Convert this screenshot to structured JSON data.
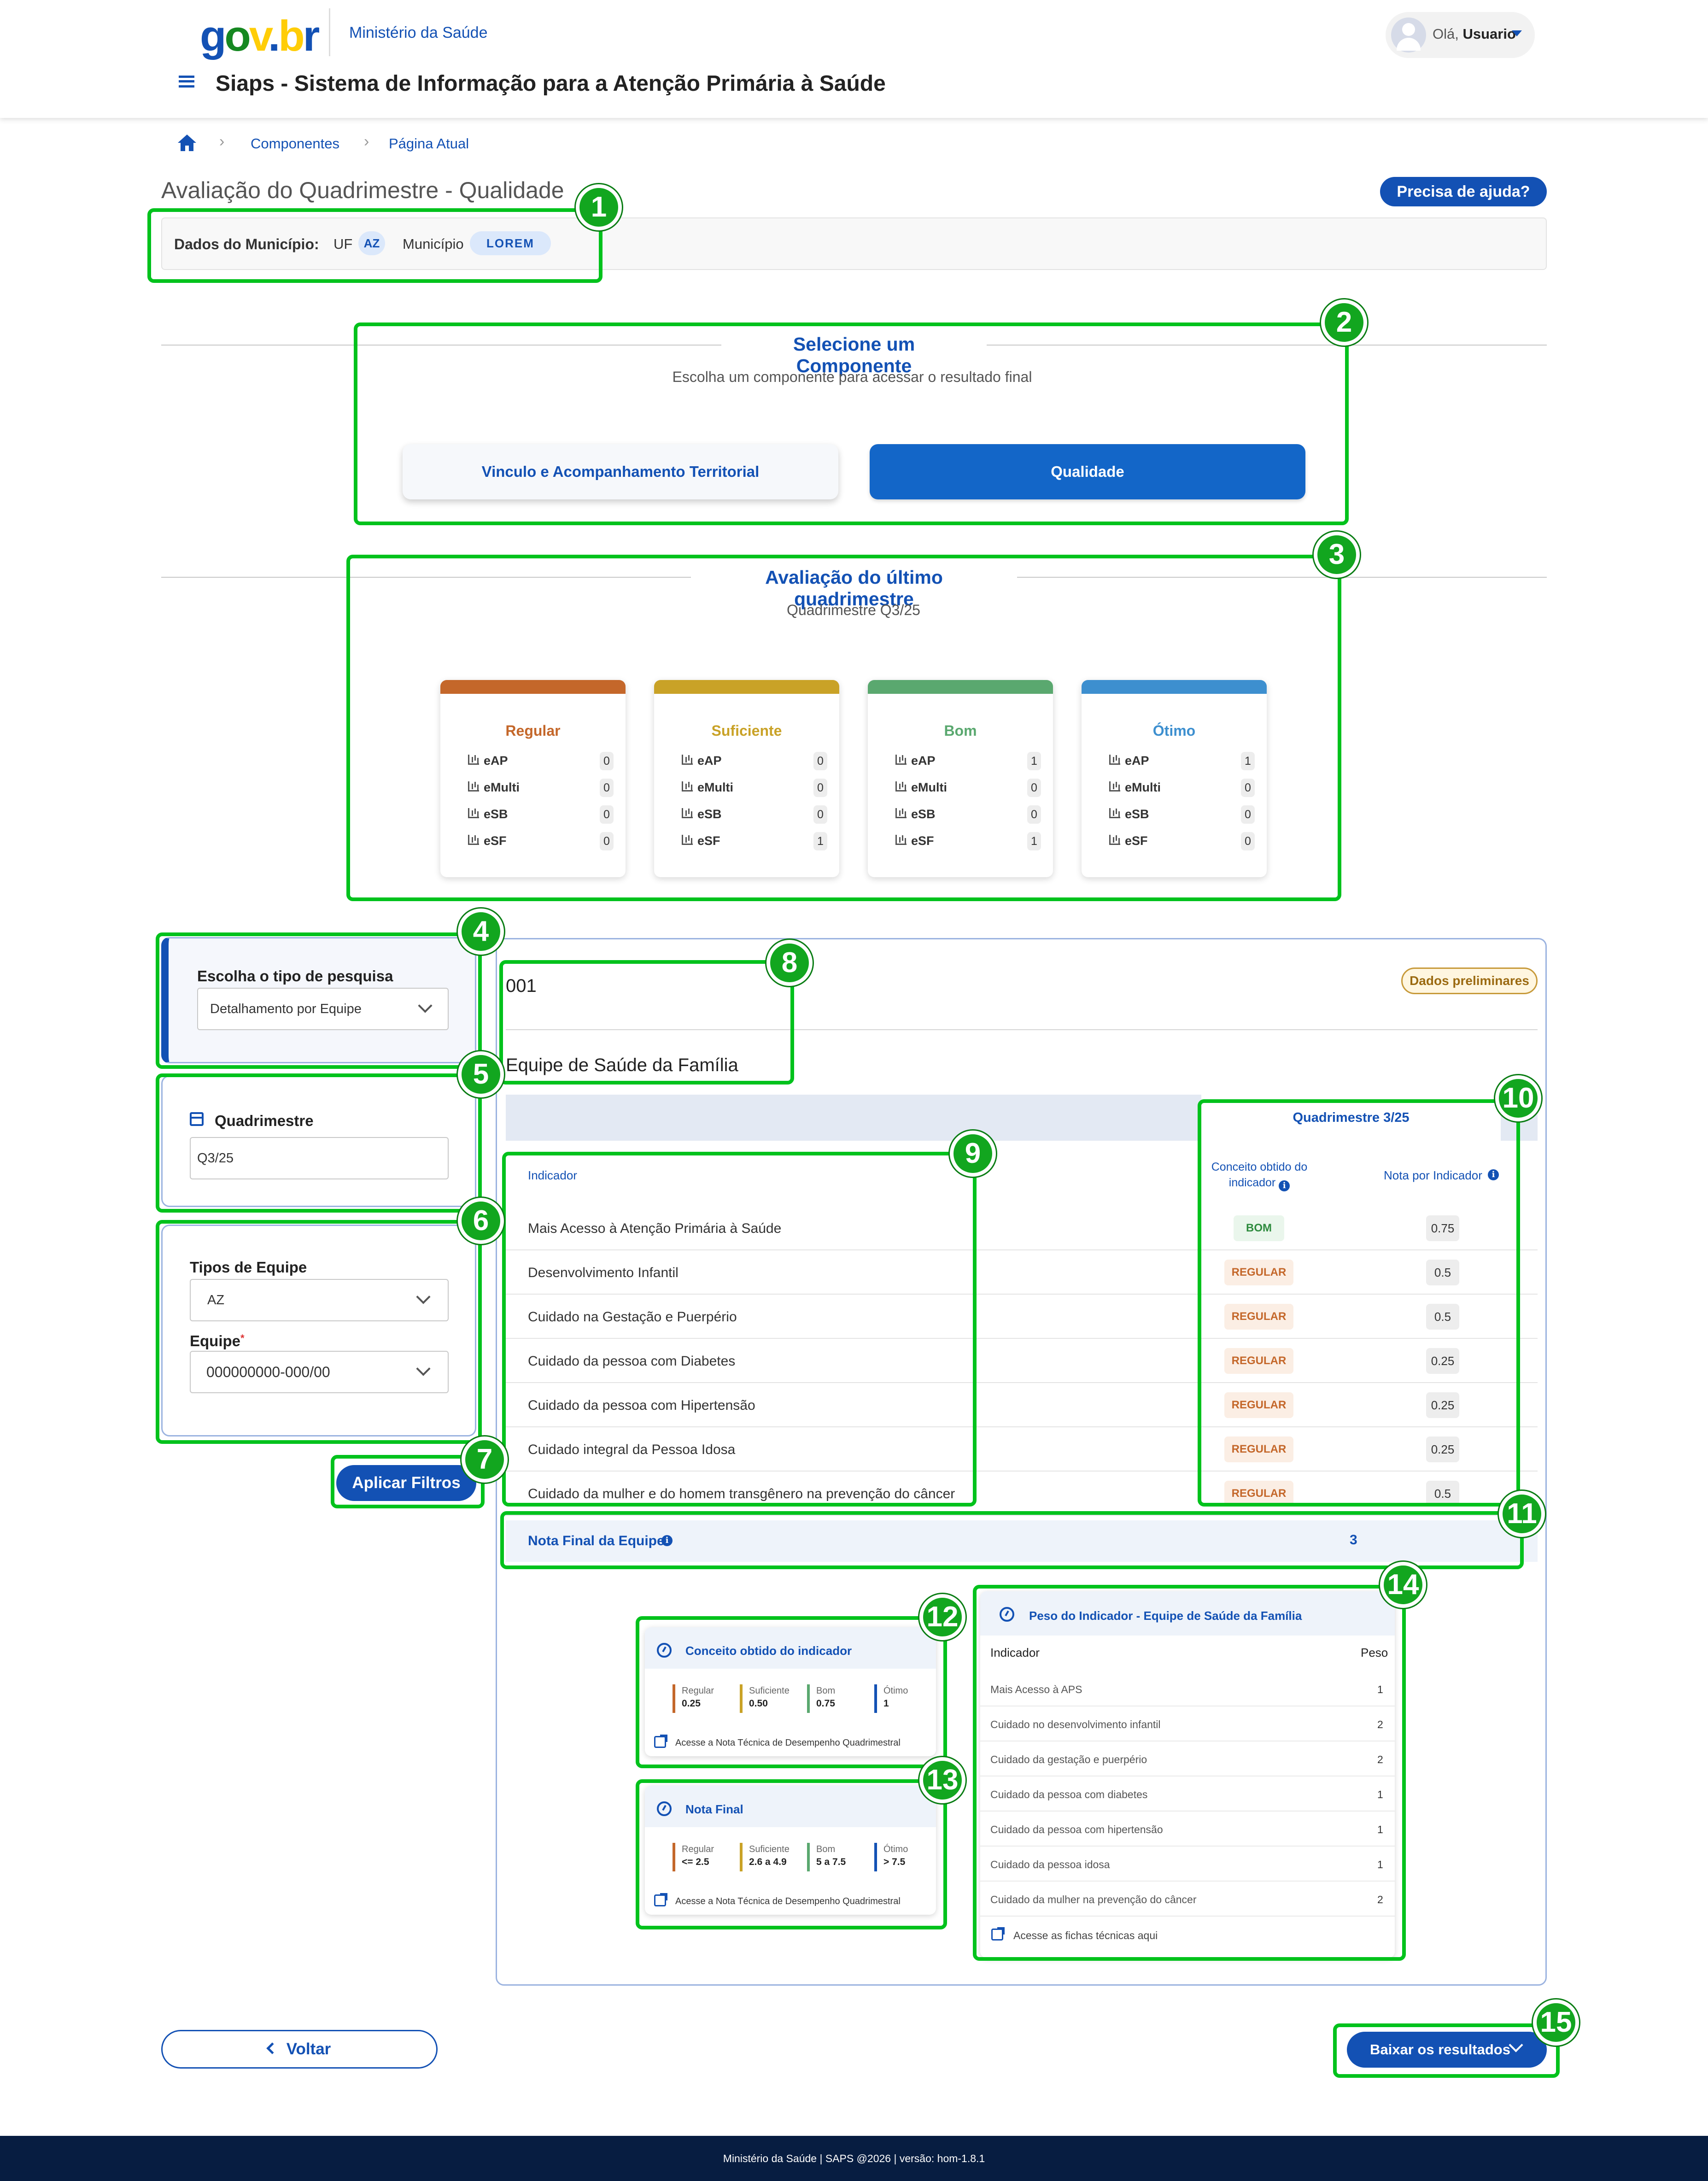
{
  "header": {
    "logo": {
      "g": "g",
      "o": "o",
      "v": "v",
      "dot": ".",
      "b": "b",
      "r": "r"
    },
    "ministry": "Ministério da Saúde",
    "user_greeting": "Olá,",
    "user_name": "Usuario",
    "system_title": "Siaps - Sistema de Informação para a Atenção Primária à Saúde"
  },
  "breadcrumb": {
    "items": [
      "Componentes",
      "Página Atual"
    ]
  },
  "page": {
    "title": "Avaliação do Quadrimestre - Qualidade",
    "help_label": "Precisa de ajuda?"
  },
  "municipio": {
    "label": "Dados do Município:",
    "uf_label": "UF",
    "uf_value": "AZ",
    "mun_label": "Município",
    "mun_value": "LOREM"
  },
  "componente": {
    "title": "Selecione um Componente",
    "subtitle": "Escolha um componente para acessar o resultado final",
    "options": [
      "Vinculo e Acompanhamento Territorial",
      "Qualidade"
    ]
  },
  "avaliacao": {
    "title": "Avaliação do último quadrimestre",
    "subtitle": "Quadrimestre Q3/25",
    "cards": [
      {
        "title": "Regular",
        "color": "#c4672a",
        "rows": [
          {
            "label": "eAP",
            "value": "0"
          },
          {
            "label": "eMulti",
            "value": "0"
          },
          {
            "label": "eSB",
            "value": "0"
          },
          {
            "label": "eSF",
            "value": "0"
          }
        ]
      },
      {
        "title": "Suficiente",
        "color": "#c9a227",
        "rows": [
          {
            "label": "eAP",
            "value": "0"
          },
          {
            "label": "eMulti",
            "value": "0"
          },
          {
            "label": "eSB",
            "value": "0"
          },
          {
            "label": "eSF",
            "value": "1"
          }
        ]
      },
      {
        "title": "Bom",
        "color": "#5aa86f",
        "rows": [
          {
            "label": "eAP",
            "value": "1"
          },
          {
            "label": "eMulti",
            "value": "0"
          },
          {
            "label": "eSB",
            "value": "0"
          },
          {
            "label": "eSF",
            "value": "1"
          }
        ]
      },
      {
        "title": "Ótimo",
        "color": "#3d8fcf",
        "rows": [
          {
            "label": "eAP",
            "value": "1"
          },
          {
            "label": "eMulti",
            "value": "0"
          },
          {
            "label": "eSB",
            "value": "0"
          },
          {
            "label": "eSF",
            "value": "0"
          }
        ]
      }
    ]
  },
  "filters": {
    "tipo_pesquisa_label": "Escolha o tipo de pesquisa",
    "tipo_pesquisa_value": "Detalhamento por Equipe",
    "quadrimestre_label": "Quadrimestre",
    "quadrimestre_value": "Q3/25",
    "tipos_equipe_label": "Tipos de Equipe",
    "tipos_equipe_value": "AZ",
    "equipe_label": "Equipe",
    "equipe_required": "*",
    "equipe_value": "000000000-000/00",
    "apply_label": "Aplicar Filtros"
  },
  "team": {
    "code": "001",
    "preliminary_badge": "Dados preliminares",
    "title": "Equipe de Saúde da Família",
    "quad_header": "Quadrimestre 3/25",
    "col_indicador": "Indicador",
    "col_conceito": "Conceito obtido do indicador",
    "col_nota": "Nota por Indicador",
    "rows": [
      {
        "name": "Mais Acesso à Atenção Primária à Saúde",
        "conceito": "BOM",
        "nota": "0.75"
      },
      {
        "name": "Desenvolvimento Infantil",
        "conceito": "REGULAR",
        "nota": "0.5"
      },
      {
        "name": "Cuidado na Gestação e Puerpério",
        "conceito": "REGULAR",
        "nota": "0.5"
      },
      {
        "name": "Cuidado da pessoa com Diabetes",
        "conceito": "REGULAR",
        "nota": "0.25"
      },
      {
        "name": "Cuidado da pessoa com Hipertensão",
        "conceito": "REGULAR",
        "nota": "0.25"
      },
      {
        "name": "Cuidado integral da Pessoa Idosa",
        "conceito": "REGULAR",
        "nota": "0.25"
      },
      {
        "name": "Cuidado da mulher e do homem transgênero na prevenção do câncer",
        "conceito": "REGULAR",
        "nota": "0.5"
      }
    ],
    "final_label": "Nota Final da Equipe",
    "final_value": "3"
  },
  "legend_conceito": {
    "title": "Conceito obtido do indicador",
    "items": [
      {
        "label": "Regular",
        "value": "0.25",
        "color": "#c4672a"
      },
      {
        "label": "Suficiente",
        "value": "0.50",
        "color": "#c9a227"
      },
      {
        "label": "Bom",
        "value": "0.75",
        "color": "#5aa86f"
      },
      {
        "label": "Ótimo",
        "value": "1",
        "color": "#1351b4"
      }
    ],
    "link": "Acesse a Nota Técnica de Desempenho Quadrimestral"
  },
  "legend_nota": {
    "title": "Nota Final",
    "items": [
      {
        "label": "Regular",
        "value": "<= 2.5",
        "color": "#c4672a"
      },
      {
        "label": "Suficiente",
        "value": "2.6 a 4.9",
        "color": "#c9a227"
      },
      {
        "label": "Bom",
        "value": "5 a 7.5",
        "color": "#5aa86f"
      },
      {
        "label": "Ótimo",
        "value": "> 7.5",
        "color": "#1351b4"
      }
    ],
    "link": "Acesse a Nota Técnica de Desempenho Quadrimestral"
  },
  "peso": {
    "title": "Peso do Indicador - Equipe de Saúde da Família",
    "col_indicador": "Indicador",
    "col_peso": "Peso",
    "rows": [
      {
        "name": "Mais Acesso à APS",
        "peso": "1"
      },
      {
        "name": "Cuidado no desenvolvimento infantil",
        "peso": "2"
      },
      {
        "name": "Cuidado da gestação e puerpério",
        "peso": "2"
      },
      {
        "name": "Cuidado da pessoa com diabetes",
        "peso": "1"
      },
      {
        "name": "Cuidado da pessoa com hipertensão",
        "peso": "1"
      },
      {
        "name": "Cuidado da pessoa idosa",
        "peso": "1"
      },
      {
        "name": "Cuidado da mulher na prevenção do câncer",
        "peso": "2"
      }
    ],
    "link": "Acesse as fichas técnicas aqui"
  },
  "actions": {
    "back_label": "Voltar",
    "download_label": "Baixar os resultados"
  },
  "footer": {
    "text": "Ministério da Saúde | SAPS @2026 | versão: hom-1.8.1"
  },
  "annotations": [
    "1",
    "2",
    "3",
    "4",
    "5",
    "6",
    "7",
    "8",
    "9",
    "10",
    "11",
    "12",
    "13",
    "14",
    "15"
  ],
  "colors": {
    "accent": "#1351b4",
    "annotation": "#00c21c",
    "regular": "#c4672a",
    "bom": "#2e8b3e"
  }
}
